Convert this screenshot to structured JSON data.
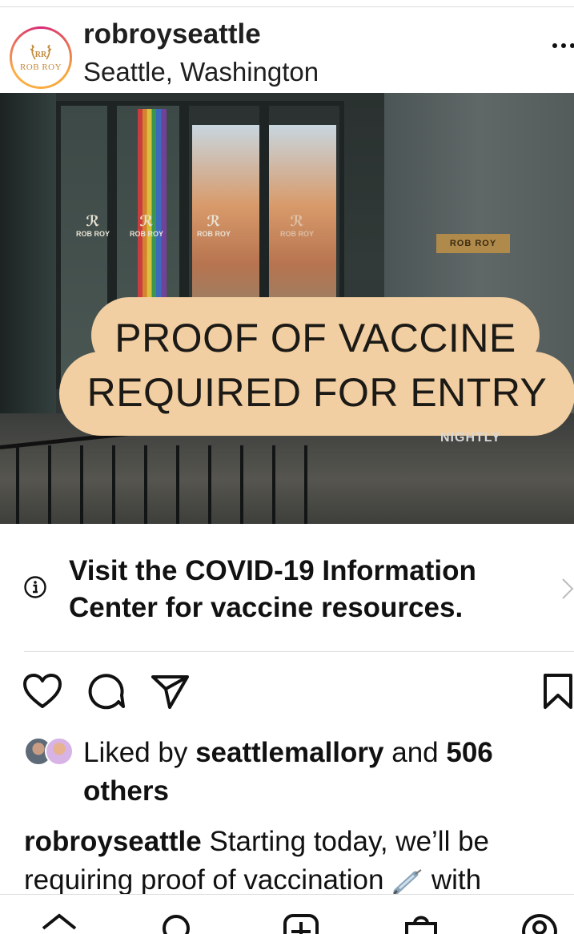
{
  "post": {
    "username": "robroyseattle",
    "location": "Seattle, Washington",
    "avatar_text": "ROB ROY"
  },
  "photo": {
    "sign_line1": "PROOF OF VACCINE",
    "sign_line2": "REQUIRED FOR ENTRY",
    "brass_plate": "ROB ROY",
    "glass_logo_text": "ROB ROY",
    "nightly_text": "NIGHTLY"
  },
  "covid_banner": {
    "text": "Visit the COVID-19 Information Center for vaccine resources."
  },
  "likes": {
    "prefix": "Liked by ",
    "user": "seattlemallory",
    "middle": " and ",
    "count": "506",
    "suffix": " others"
  },
  "caption": {
    "username": "robroyseattle",
    "text_before_emoji": " Starting today, we’ll be requiring proof of vaccination ",
    "text_after_emoji": " with"
  },
  "icons": {
    "like": "heart-icon",
    "comment": "comment-icon",
    "share": "send-icon",
    "save": "bookmark-icon",
    "info": "info-icon",
    "chevron": "chevron-right-icon"
  },
  "colors": {
    "sign": "#f2cfa2",
    "text": "#111111",
    "divider": "#dcdcdc"
  }
}
